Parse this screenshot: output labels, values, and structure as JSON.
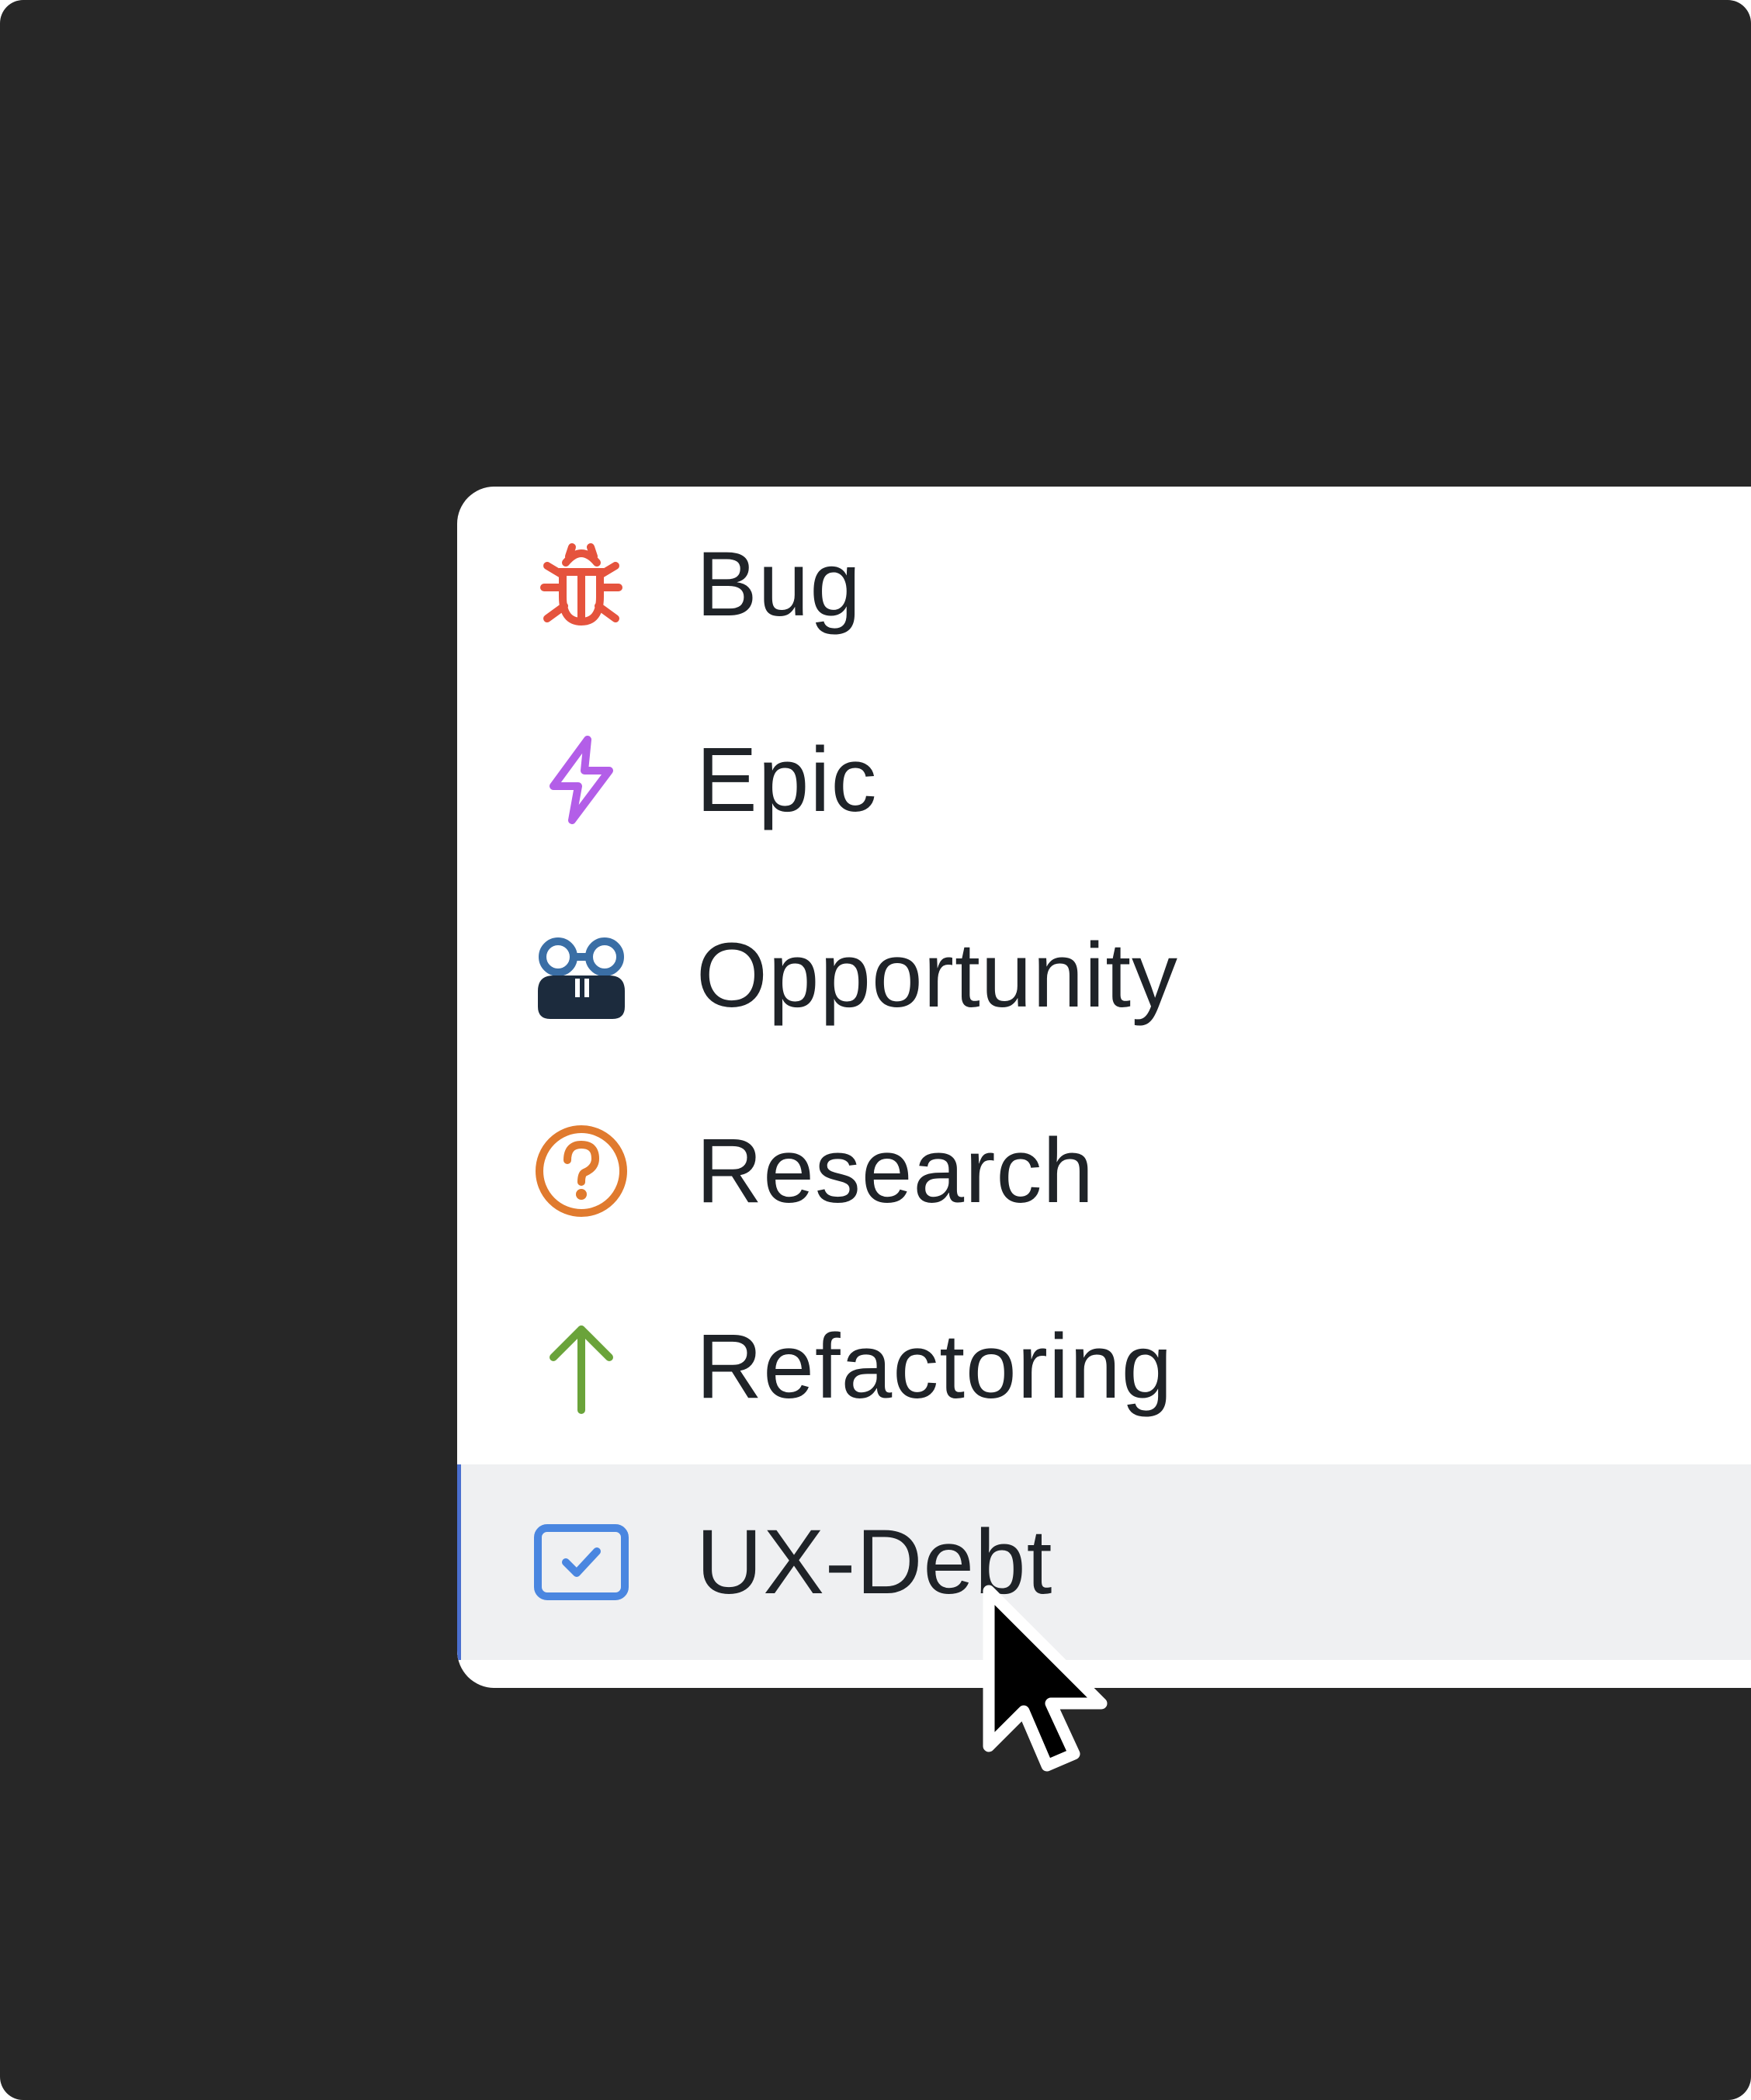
{
  "menu": {
    "items": [
      {
        "label": "Bug",
        "icon": "bug-icon",
        "color": "#e5533d"
      },
      {
        "label": "Epic",
        "icon": "lightning-icon",
        "color": "#b35ee8"
      },
      {
        "label": "Opportunity",
        "icon": "binoculars-icon",
        "color": "#3a6ea5"
      },
      {
        "label": "Research",
        "icon": "question-circle-icon",
        "color": "#e07a2e"
      },
      {
        "label": "Refactoring",
        "icon": "arrow-up-icon",
        "color": "#6aa33a"
      },
      {
        "label": "UX-Debt",
        "icon": "checkbox-icon",
        "color": "#4a86e0"
      }
    ],
    "selected_index": 5
  },
  "colors": {
    "background": "#272727",
    "menu_background": "#ffffff",
    "selected_row": "#eff0f2",
    "selected_indicator": "#4a6fd0",
    "text": "#1f2328"
  }
}
